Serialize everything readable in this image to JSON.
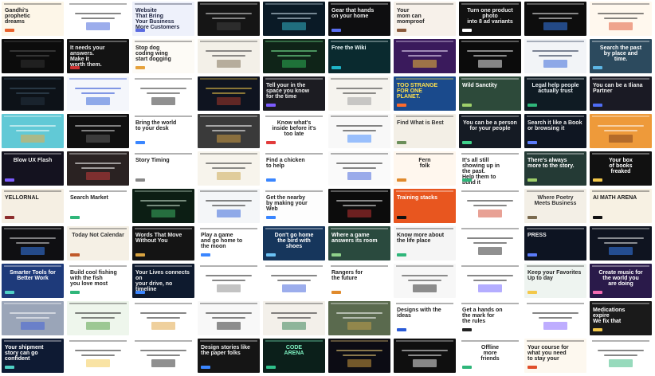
{
  "tiles": [
    {
      "bg": "#fdf6e8",
      "fg": "#222222",
      "accent": "#e8612c",
      "text": "Gandhi's\nprophetic\ndreams"
    },
    {
      "bg": "#ffffff",
      "fg": "#222222",
      "accent": "#3a5bd9",
      "text": ""
    },
    {
      "bg": "#eef1fb",
      "fg": "#1d2340",
      "accent": "#5b6be0",
      "text": "Website\nThat Bring\nYour Business\nMore Customers"
    },
    {
      "bg": "#151515",
      "fg": "#dddddd",
      "accent": "#444444",
      "text": ""
    },
    {
      "bg": "#0a1a26",
      "fg": "#cfe3ee",
      "accent": "#35c2d6",
      "text": ""
    },
    {
      "bg": "#0e0e10",
      "fg": "#eeeeee",
      "accent": "#5a6ef0",
      "text": "Gear that hands\non your home"
    },
    {
      "bg": "#f7f1ea",
      "fg": "#222222",
      "accent": "#8a5a3c",
      "text": "Your\nmom can\nmomproof"
    },
    {
      "bg": "#111111",
      "fg": "#eeeeee",
      "accent": "#ffffff",
      "text": "Turn one product photo\ninto 8 ad variants"
    },
    {
      "bg": "#0d0d0d",
      "fg": "#eeeeee",
      "accent": "#3a86ff",
      "text": ""
    },
    {
      "bg": "#fff8ee",
      "fg": "#222222",
      "accent": "#e04f2b",
      "text": ""
    },
    {
      "bg": "#0c0c0c",
      "fg": "#555555",
      "accent": "#333333",
      "text": ""
    },
    {
      "bg": "#131313",
      "fg": "#eeeeee",
      "accent": "#c33",
      "text": "It needs your\nanswers.\nMake it\nworth them."
    },
    {
      "bg": "#fdfbf6",
      "fg": "#222222",
      "accent": "#e6a23c",
      "text": "Stop dog\ncoding wing\nstart dogging"
    },
    {
      "bg": "#f3f0e8",
      "fg": "#333333",
      "accent": "#7a6a4f",
      "text": ""
    },
    {
      "bg": "#0f2418",
      "fg": "#7ef29a",
      "accent": "#2fbf5a",
      "text": ""
    },
    {
      "bg": "#0a2a2f",
      "fg": "#e8f5f6",
      "accent": "#1fb5c9",
      "text": "Free the Wiki"
    },
    {
      "bg": "#3a1a5c",
      "fg": "#f3e8ff",
      "accent": "#ffcc33",
      "text": ""
    },
    {
      "bg": "#0b0b0b",
      "fg": "#eeeeee",
      "accent": "#ffffff",
      "text": ""
    },
    {
      "bg": "#f2f4f7",
      "fg": "#1a2744",
      "accent": "#2a5bd7",
      "text": ""
    },
    {
      "bg": "#2c4a5e",
      "fg": "#ffffff",
      "accent": "#5db6e5",
      "text": "Search the past\nby place and\ntime."
    },
    {
      "bg": "#0d1218",
      "fg": "#3f566a",
      "accent": "#253442",
      "text": ""
    },
    {
      "bg": "#f4f6fb",
      "fg": "#2147d1",
      "accent": "#2a5bd7",
      "text": ""
    },
    {
      "bg": "#ffffff",
      "fg": "#333333",
      "accent": "#222222",
      "text": ""
    },
    {
      "bg": "#0f1420",
      "fg": "#f3c84a",
      "accent": "#b43a2a",
      "text": ""
    },
    {
      "bg": "#1c1c22",
      "fg": "#eeeeee",
      "accent": "#7d5cff",
      "text": "Tell your in the\nspace you know\nfor the time"
    },
    {
      "bg": "#f5f3ee",
      "fg": "#333333",
      "accent": "#999999",
      "text": ""
    },
    {
      "bg": "#1a4a8c",
      "fg": "#ffe14d",
      "accent": "#ff6b2b",
      "text": "TOO STRANGE\nFOR ONE\nPLANET."
    },
    {
      "bg": "#2d4a3a",
      "fg": "#ffffff",
      "accent": "#9ecf6a",
      "text": "Wild Sanctity"
    },
    {
      "bg": "#0f1b23",
      "fg": "#e8eef2",
      "accent": "#2fb67a",
      "text": "Legal help people\nactually trust"
    },
    {
      "bg": "#1a1a24",
      "fg": "#eeeeee",
      "accent": "#4f6df5",
      "text": "You can be a Iliana\nPartner"
    },
    {
      "bg": "#61c9d6",
      "fg": "#ffffff",
      "accent": "#f3a93c",
      "text": ""
    },
    {
      "bg": "#101010",
      "fg": "#dddddd",
      "accent": "#666666",
      "text": ""
    },
    {
      "bg": "#ffffff",
      "fg": "#222222",
      "accent": "#3a86ff",
      "text": "Bring the world\nto your desk"
    },
    {
      "bg": "#3a3a3a",
      "fg": "#ffffff",
      "accent": "#d9a441",
      "text": ""
    },
    {
      "bg": "#ffffff",
      "fg": "#222222",
      "accent": "#e23c3c",
      "text": "Know what's\ninside before it's\ntoo late"
    },
    {
      "bg": "#f8f8f8",
      "fg": "#222222",
      "accent": "#3a86ff",
      "text": ""
    },
    {
      "bg": "#f3efe6",
      "fg": "#333333",
      "accent": "#6b8f5a",
      "text": "Find What is Best"
    },
    {
      "bg": "#151b24",
      "fg": "#eeeeee",
      "accent": "#3fd18a",
      "text": "You can be a person\nfor your people"
    },
    {
      "bg": "#0f1622",
      "fg": "#eeeeee",
      "accent": "#5b7cfa",
      "text": "Search it like a Book\nor browsing it"
    },
    {
      "bg": "#ee9a3a",
      "fg": "#ffffff",
      "accent": "#7a3b1a",
      "text": ""
    },
    {
      "bg": "#14121f",
      "fg": "#eeeeee",
      "accent": "#7d5cff",
      "text": "Blow UX Flash"
    },
    {
      "bg": "#2a2222",
      "fg": "#ffffff",
      "accent": "#d23c3c",
      "text": ""
    },
    {
      "bg": "#ffffff",
      "fg": "#222222",
      "accent": "#888888",
      "text": "Story Timing"
    },
    {
      "bg": "#f7f4ec",
      "fg": "#333333",
      "accent": "#c9a44a",
      "text": ""
    },
    {
      "bg": "#ffffff",
      "fg": "#222222",
      "accent": "#3a86ff",
      "text": "Find a chicken\nto help"
    },
    {
      "bg": "#fafafa",
      "fg": "#222222",
      "accent": "#3a5bd9",
      "text": ""
    },
    {
      "bg": "#fff7ee",
      "fg": "#222222",
      "accent": "#e08a2c",
      "text": "Fern\nfolk"
    },
    {
      "bg": "#ffffff",
      "fg": "#222222",
      "accent": "#2fb67a",
      "text": "It's all still\nshowing up in\nthe past.\nHelp them to\nbuild it"
    },
    {
      "bg": "#243a35",
      "fg": "#ffffff",
      "accent": "#9ecf6a",
      "text": "There's always\nmore to the story."
    },
    {
      "bg": "#111111",
      "fg": "#ffffff",
      "accent": "#f3c84a",
      "text": "Your box\nof books\nfreaked"
    },
    {
      "bg": "#f5efe3",
      "fg": "#222222",
      "accent": "#8c2d2d",
      "text": "YELLORNAL"
    },
    {
      "bg": "#ffffff",
      "fg": "#222222",
      "accent": "#2fb67a",
      "text": "Search Market"
    },
    {
      "bg": "#0c1e14",
      "fg": "#cfe8d4",
      "accent": "#3fbf6a",
      "text": ""
    },
    {
      "bg": "#f4f6f8",
      "fg": "#222222",
      "accent": "#2a5bd7",
      "text": ""
    },
    {
      "bg": "#fdfdfd",
      "fg": "#222222",
      "accent": "#3a86ff",
      "text": "Get the nearby\nby making your\nWeb"
    },
    {
      "bg": "#0c0c0c",
      "fg": "#eeeeee",
      "accent": "#c33",
      "text": ""
    },
    {
      "bg": "#e8561f",
      "fg": "#ffffff",
      "accent": "#111111",
      "text": "Training stacks"
    },
    {
      "bg": "#ffffff",
      "fg": "#222222",
      "accent": "#d2432c",
      "text": ""
    },
    {
      "bg": "#f3efe6",
      "fg": "#333333",
      "accent": "#7a6a4f",
      "text": "Where Poetry\nMeets Business"
    },
    {
      "bg": "#f7f1e3",
      "fg": "#1a1a1a",
      "accent": "#111111",
      "text": "AI MATH ARENA"
    },
    {
      "bg": "#0f0f12",
      "fg": "#dddddd",
      "accent": "#3a86ff",
      "text": ""
    },
    {
      "bg": "#f5f0e5",
      "fg": "#333333",
      "accent": "#c05a2a",
      "text": "Today Not Calendar"
    },
    {
      "bg": "#141414",
      "fg": "#eeeeee",
      "accent": "#d9a441",
      "text": "Words That Move\nWithout You"
    },
    {
      "bg": "#ffffff",
      "fg": "#222222",
      "accent": "#3a86ff",
      "text": "Play a game\nand go home to\nthe moon"
    },
    {
      "bg": "#16365c",
      "fg": "#ffffff",
      "accent": "#6cc3f5",
      "text": "Don't go home\nthe bird with\nshoes"
    },
    {
      "bg": "#2a4a3e",
      "fg": "#ffffff",
      "accent": "#8fd18a",
      "text": "Where a game\nanswers its room"
    },
    {
      "bg": "#f5f5f5",
      "fg": "#222222",
      "accent": "#2fb67a",
      "text": "Know more about\nthe life place"
    },
    {
      "bg": "#ffffff",
      "fg": "#222222",
      "accent": "#222222",
      "text": ""
    },
    {
      "bg": "#0d1422",
      "fg": "#eeeeee",
      "accent": "#5b7cfa",
      "text": "PRESS"
    },
    {
      "bg": "#0f1420",
      "fg": "#eeeeee",
      "accent": "#3a86ff",
      "text": ""
    },
    {
      "bg": "#1e3a7a",
      "fg": "#ffffff",
      "accent": "#4fd1c5",
      "text": "Smarter Tools for\nBetter Work"
    },
    {
      "bg": "#ffffff",
      "fg": "#222222",
      "accent": "#2fb67a",
      "text": "Build cool fishing\nwith the fish\nyou love most"
    },
    {
      "bg": "#0e1a2e",
      "fg": "#eeeeee",
      "accent": "#3a86ff",
      "text": "Your Lives connects on\nyour drive, no timeline"
    },
    {
      "bg": "#ffffff",
      "fg": "#222222",
      "accent": "#888888",
      "text": ""
    },
    {
      "bg": "#ffffff",
      "fg": "#222222",
      "accent": "#3a5bd9",
      "text": ""
    },
    {
      "bg": "#ffffff",
      "fg": "#222222",
      "accent": "#e08a2c",
      "text": "Rangers for\nthe future"
    },
    {
      "bg": "#f7f7f7",
      "fg": "#333333",
      "accent": "#222222",
      "text": ""
    },
    {
      "bg": "#ffffff",
      "fg": "#222222",
      "accent": "#6a5cff",
      "text": ""
    },
    {
      "bg": "#eef4f0",
      "fg": "#222222",
      "accent": "#f3c84a",
      "text": "Keep your Favorites\nUp to day"
    },
    {
      "bg": "#2a1a4a",
      "fg": "#ffffff",
      "accent": "#f36bb2",
      "text": "Create music for\nthe world you\nare doing"
    },
    {
      "bg": "#9aa5b8",
      "fg": "#ffffff",
      "accent": "#3a5bd9",
      "text": ""
    },
    {
      "bg": "#eef6ec",
      "fg": "#222222",
      "accent": "#4a9a3a",
      "text": ""
    },
    {
      "bg": "#ffffff",
      "fg": "#222222",
      "accent": "#e0a23c",
      "text": ""
    },
    {
      "bg": "#f8f8f8",
      "fg": "#222222",
      "accent": "#222222",
      "text": ""
    },
    {
      "bg": "#f3f0ea",
      "fg": "#222222",
      "accent": "#2a7a4a",
      "text": ""
    },
    {
      "bg": "#5a6a4e",
      "fg": "#ffffff",
      "accent": "#c9a44a",
      "text": ""
    },
    {
      "bg": "#ffffff",
      "fg": "#222222",
      "accent": "#2a5bd7",
      "text": "Designs with the ideas"
    },
    {
      "bg": "#ffffff",
      "fg": "#222222",
      "accent": "#222222",
      "text": "Get a hands on\nthe mark for\nthe rules"
    },
    {
      "bg": "#ffffff",
      "fg": "#222222",
      "accent": "#7d5cff",
      "text": ""
    },
    {
      "bg": "#1a1a1a",
      "fg": "#ffffff",
      "accent": "#f3c84a",
      "text": "Medications\nexpire\nWe fix that"
    },
    {
      "bg": "#0e1a33",
      "fg": "#ffffff",
      "accent": "#4fd1c5",
      "text": "Your shipment\nstory can go\nconfident"
    },
    {
      "bg": "#ffffff",
      "fg": "#222222",
      "accent": "#f3c84a",
      "text": ""
    },
    {
      "bg": "#ffffff",
      "fg": "#222222",
      "accent": "#222222",
      "text": ""
    },
    {
      "bg": "#151515",
      "fg": "#eeeeee",
      "accent": "#3a86ff",
      "text": "Design stories like\nthe paper folks"
    },
    {
      "bg": "#0b1f1a",
      "fg": "#7ef2c2",
      "accent": "#2fbf8a",
      "text": "CODE\nARENA"
    },
    {
      "bg": "#0c0c14",
      "fg": "#f3d27a",
      "accent": "#d9a441",
      "text": ""
    },
    {
      "bg": "#0f0f0f",
      "fg": "#eeeeee",
      "accent": "#ffffff",
      "text": ""
    },
    {
      "bg": "#ffffff",
      "fg": "#222222",
      "accent": "#2fb67a",
      "text": "Offline\nmore\nfriends"
    },
    {
      "bg": "#fdf8ef",
      "fg": "#222222",
      "accent": "#e04f2b",
      "text": "Your course for\nwhat you need\nto stay your"
    },
    {
      "bg": "#ffffff",
      "fg": "#222222",
      "accent": "#2fb67a",
      "text": ""
    }
  ]
}
